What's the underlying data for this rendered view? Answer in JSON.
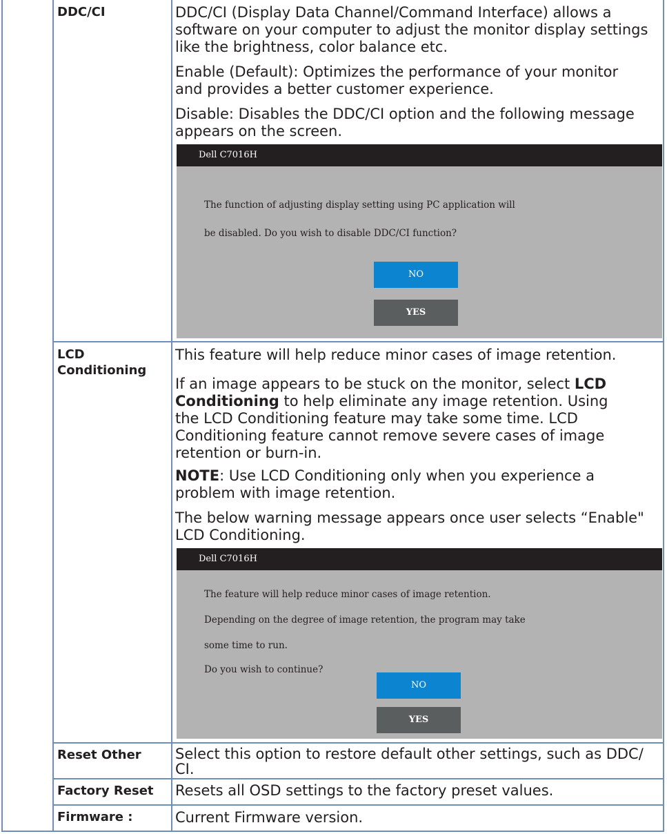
{
  "ddc": {
    "label": "DDC/CI",
    "p1a": "DDC/CI (Display Data Channel/Command Interface) allows a",
    "p1b": "software on your computer to adjust the monitor display settings",
    "p1c": "like the brightness, color balance etc.",
    "p2a": "Enable (Default): Optimizes the performance of your monitor",
    "p2b": "and provides a better customer experience.",
    "p3a": "Disable: Disables the DDC/CI option and the following message",
    "p3b": "appears on the screen.",
    "dialog": {
      "title": "Dell  C7016H",
      "msg1": "The function of adjusting display setting using PC application will",
      "msg2": "be disabled. Do you wish to disable DDC/CI function?",
      "no": "NO",
      "yes": "YES"
    }
  },
  "lcd": {
    "label1": "LCD",
    "label2": "Conditioning",
    "p1": "This feature will help reduce minor cases of image retention.",
    "p2a_pre": "If an image appears to be stuck on the monitor, select ",
    "p2a_b": "LCD",
    "p2b_b": "Conditioning",
    "p2b_post": " to help eliminate any image retention. Using",
    "p2c": "the LCD Conditioning feature may take some time. LCD",
    "p2d": "Conditioning feature cannot remove  severe cases of image",
    "p2e": "retention or burn-in.",
    "note_b": "NOTE",
    "note_a": ": Use LCD Conditioning only when you experience a",
    "note_b2": "problem with image retention.",
    "p4a": "The below warning message appears once user selects “Enable\"",
    "p4b": "LCD Conditioning.",
    "dialog": {
      "title": "Dell  C7016H",
      "msg1": "The feature will help reduce minor cases of image retention.",
      "msg2": "Depending on the degree of image retention, the program may take",
      "msg3": "some time to run.",
      "msg4": "Do you wish to continue?",
      "no": "NO",
      "yes": "YES"
    }
  },
  "reset_other": {
    "label": "Reset Other",
    "text1": "Select this option to restore default other settings, such as DDC/",
    "text2": "CI."
  },
  "factory_reset": {
    "label": "Factory Reset",
    "text": "Resets all OSD settings to the factory preset values."
  },
  "firmware": {
    "label": "Firmware :",
    "text": "Current Firmware version."
  }
}
